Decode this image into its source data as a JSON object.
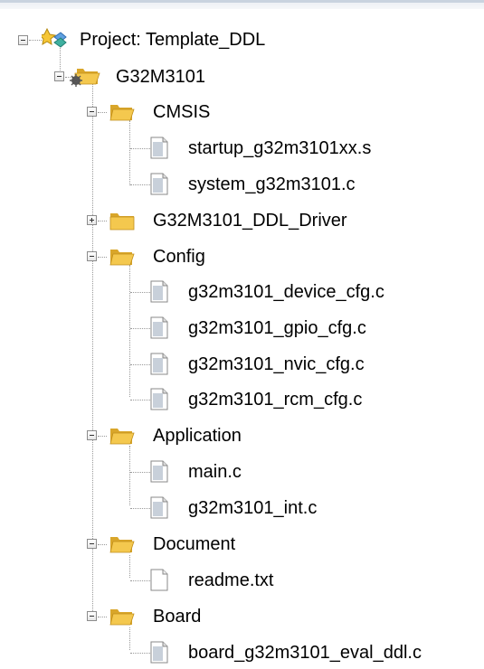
{
  "tree": {
    "project_label": "Project: Template_DDL",
    "target_label": "G32M3101",
    "groups": [
      {
        "label": "CMSIS",
        "expanded": true,
        "files": [
          "startup_g32m3101xx.s",
          "system_g32m3101.c"
        ]
      },
      {
        "label": "G32M3101_DDL_Driver",
        "expanded": false,
        "files": []
      },
      {
        "label": "Config",
        "expanded": true,
        "files": [
          "g32m3101_device_cfg.c",
          "g32m3101_gpio_cfg.c",
          "g32m3101_nvic_cfg.c",
          "g32m3101_rcm_cfg.c"
        ]
      },
      {
        "label": "Application",
        "expanded": true,
        "files": [
          "main.c",
          "g32m3101_int.c"
        ]
      },
      {
        "label": "Document",
        "expanded": true,
        "files": [
          "readme.txt"
        ]
      },
      {
        "label": "Board",
        "expanded": true,
        "files": [
          "board_g32m3101_eval_ddl.c"
        ]
      }
    ]
  },
  "icons": {
    "project": "project-icon",
    "target": "target-folder-icon",
    "group_open": "open-folder-icon",
    "group_closed": "closed-folder-icon",
    "source_file": "source-file-icon",
    "text_file": "text-file-icon"
  },
  "colors": {
    "folder_fill": "#f4c84e",
    "folder_dark": "#d9a62a",
    "tree_line": "#9a9a9a",
    "toggle_border": "#8c8c8c"
  }
}
